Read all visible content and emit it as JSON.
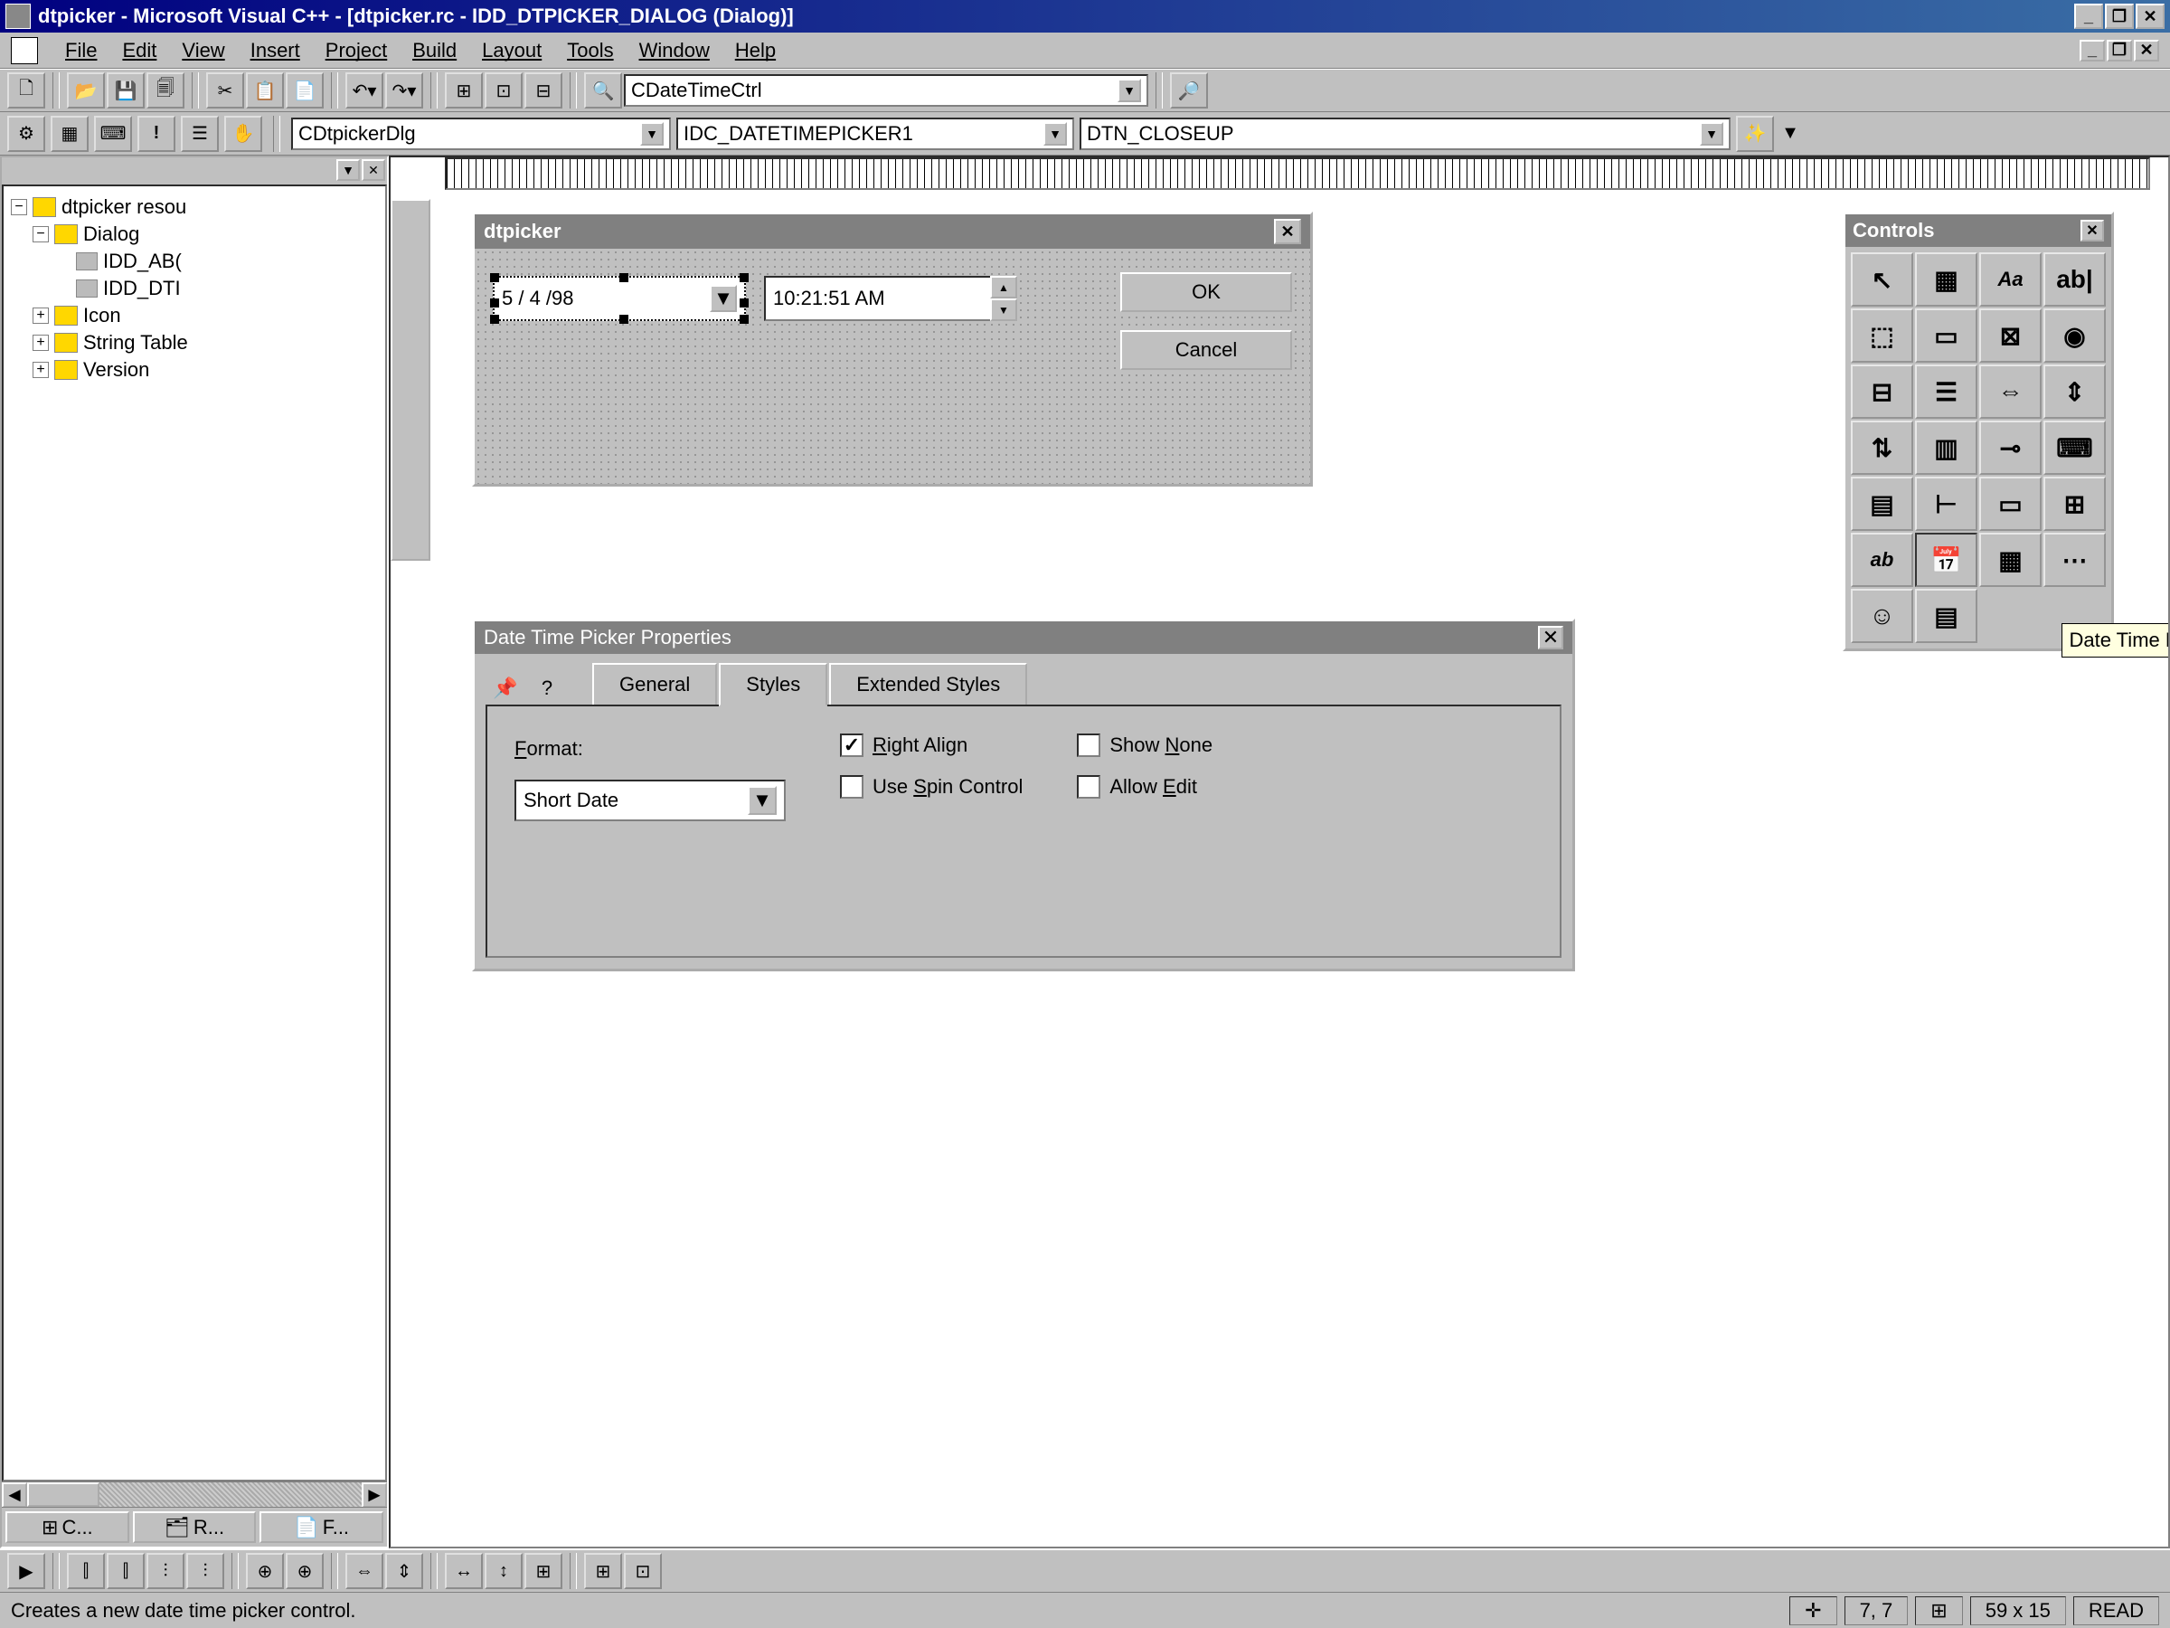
{
  "titlebar": {
    "text": "dtpicker - Microsoft Visual C++ - [dtpicker.rc - IDD_DTPICKER_DIALOG (Dialog)]"
  },
  "menus": {
    "file": "File",
    "edit": "Edit",
    "view": "View",
    "insert": "Insert",
    "project": "Project",
    "build": "Build",
    "layout": "Layout",
    "tools": "Tools",
    "window": "Window",
    "help": "Help"
  },
  "toolbar": {
    "class_combo": "CDateTimeCtrl"
  },
  "toolbar2": {
    "combo1": "CDtpickerDlg",
    "combo2": "IDC_DATETIMEPICKER1",
    "combo3": "DTN_CLOSEUP"
  },
  "tree": {
    "root": "dtpicker resou",
    "dialog": "Dialog",
    "idd_abo": "IDD_AB(",
    "idd_dtp": "IDD_DTI",
    "icon": "Icon",
    "string_table": "String Table",
    "version": "Version"
  },
  "sidebar_tabs": {
    "t1": "C...",
    "t2": "R...",
    "t3": "F..."
  },
  "dialog": {
    "title": "dtpicker",
    "date": "5 / 4 /98",
    "time": "10:21:51 AM",
    "ok": "OK",
    "cancel": "Cancel"
  },
  "props": {
    "title": "Date Time Picker Properties",
    "tab_general": "General",
    "tab_styles": "Styles",
    "tab_extended": "Extended Styles",
    "format_label": "Format:",
    "format_value": "Short Date",
    "right_align": "Right Align",
    "use_spin": "Use Spin Control",
    "show_none": "Show None",
    "allow_edit": "Allow Edit"
  },
  "palette": {
    "title": "Controls",
    "tooltip": "Date Time Picker"
  },
  "status": {
    "text": "Creates a new date time picker control.",
    "pos": "7, 7",
    "size": "59 x 15",
    "read": "READ"
  }
}
